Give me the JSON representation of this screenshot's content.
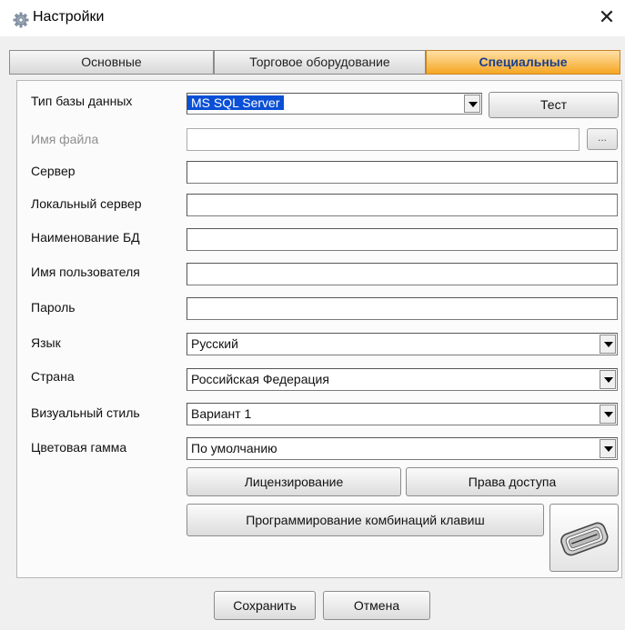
{
  "window": {
    "title": "Настройки"
  },
  "tabs": [
    {
      "label": "Основные"
    },
    {
      "label": "Торговое оборудование"
    },
    {
      "label": "Специальные"
    }
  ],
  "form": {
    "db_type": {
      "label": "Тип базы данных",
      "value": "MS SQL Server",
      "test_label": "Тест"
    },
    "file_name": {
      "label": "Имя файла",
      "value": "",
      "browse_label": "..."
    },
    "server": {
      "label": "Сервер",
      "value": ""
    },
    "local_server": {
      "label": "Локальный сервер",
      "value": ""
    },
    "db_name": {
      "label": "Наименование БД",
      "value": ""
    },
    "user_name": {
      "label": "Имя пользователя",
      "value": ""
    },
    "password": {
      "label": "Пароль",
      "value": ""
    },
    "language": {
      "label": "Язык",
      "value": "Русский"
    },
    "country": {
      "label": "Страна",
      "value": "Российская Федерация"
    },
    "visual_style": {
      "label": "Визуальный стиль",
      "value": "Вариант 1"
    },
    "color_scheme": {
      "label": "Цветовая гамма",
      "value": "По умолчанию"
    }
  },
  "buttons": {
    "licensing": "Лицензирование",
    "access_rights": "Права доступа",
    "hotkeys": "Программирование комбинаций клавиш",
    "save": "Сохранить",
    "cancel": "Отмена"
  },
  "icons": {
    "title": "gear-icon",
    "close": "close-icon",
    "device": "card-reader-icon",
    "dropdown": "dropdown-arrow-icon"
  },
  "colors": {
    "active_tab": "#f5a623",
    "active_tab_text": "#1a3f8c",
    "selection": "#0a4fd6"
  }
}
